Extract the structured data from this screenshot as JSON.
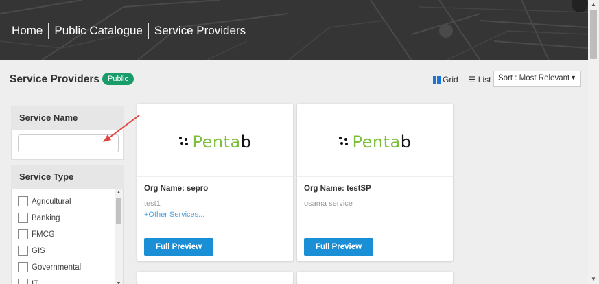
{
  "header": {
    "breadcrumb": [
      "Home",
      "Public Catalogue",
      "Service Providers"
    ]
  },
  "page": {
    "title": "Service Providers",
    "badge": "Public",
    "view_grid": "Grid",
    "view_list": "List",
    "sort_value": "Sort : Most Relevant"
  },
  "filters": {
    "service_name_label": "Service Name",
    "service_name_value": "",
    "service_type_label": "Service Type",
    "service_types": [
      "Agricultural",
      "Banking",
      "FMCG",
      "GIS",
      "Governmental",
      "IT"
    ]
  },
  "cards": [
    {
      "logo_prefix": "Penta",
      "logo_suffix": "b",
      "org": "Org Name: sepro",
      "desc": "test1",
      "more": "+Other Services...",
      "button": "Full Preview"
    },
    {
      "logo_prefix": "Penta",
      "logo_suffix": "b",
      "org": "Org Name: testSP",
      "desc": "osama service",
      "more": "",
      "button": "Full Preview"
    }
  ],
  "colors": {
    "badge": "#1a9b6a",
    "button": "#1a8fd6",
    "logo_green": "#7bbf3a",
    "arrow": "#e0443a"
  }
}
